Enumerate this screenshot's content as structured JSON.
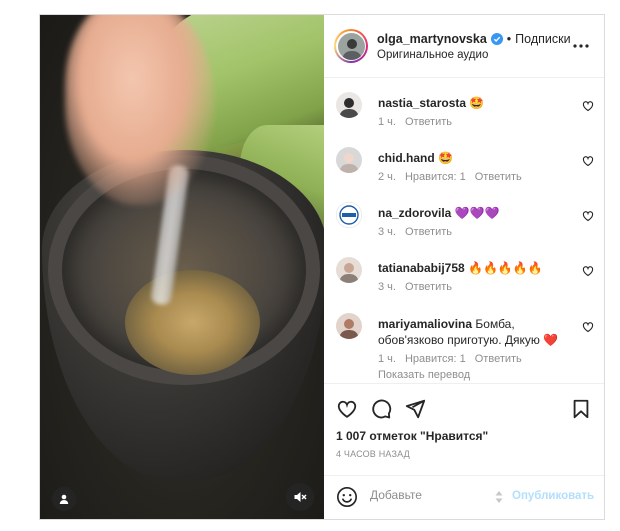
{
  "header": {
    "username": "olga_martynovska",
    "separator": "•",
    "follow_label": "Подписки",
    "audio_label": "Оригинальное аудио"
  },
  "comments": [
    {
      "user": "nastia_starosta",
      "text": "🤩",
      "time": "1 ч.",
      "likes": "",
      "reply": "Ответить"
    },
    {
      "user": "chid.hand",
      "text": "🤩",
      "time": "2 ч.",
      "likes": "Нравится: 1",
      "reply": "Ответить"
    },
    {
      "user": "na_zdorovila",
      "text": "💜💜💜",
      "time": "3 ч.",
      "likes": "",
      "reply": "Ответить"
    },
    {
      "user": "tatianababij758",
      "text": "🔥🔥🔥🔥🔥",
      "time": "3 ч.",
      "likes": "",
      "reply": "Ответить"
    },
    {
      "user": "mariyamaliovina",
      "text": "Бомба, обов'язково приготую. Дякую ❤️",
      "time": "1 ч.",
      "likes": "Нравится: 1",
      "reply": "Ответить",
      "translate": "Показать перевод"
    }
  ],
  "actions": {
    "likes_count": "1 007 отметок \"Нравится\"",
    "date": "4 ЧАСОВ НАЗАД"
  },
  "composer": {
    "placeholder": "Добавьте",
    "publish_label": "Опубликовать"
  },
  "colors": {
    "verified": "#3897f0",
    "link_disabled": "#b2dffc",
    "meta_text": "#8e8e8e",
    "heart_red": "#ed4956",
    "purple_heart": "#8b5cf6"
  },
  "icons": {
    "more": "more-horizontal-icon",
    "like": "heart-icon",
    "comment": "speech-bubble-icon",
    "share": "paper-plane-icon",
    "save": "bookmark-icon",
    "emoji": "smiley-icon",
    "mute": "speaker-muted-icon",
    "user_tag": "user-tag-icon"
  }
}
